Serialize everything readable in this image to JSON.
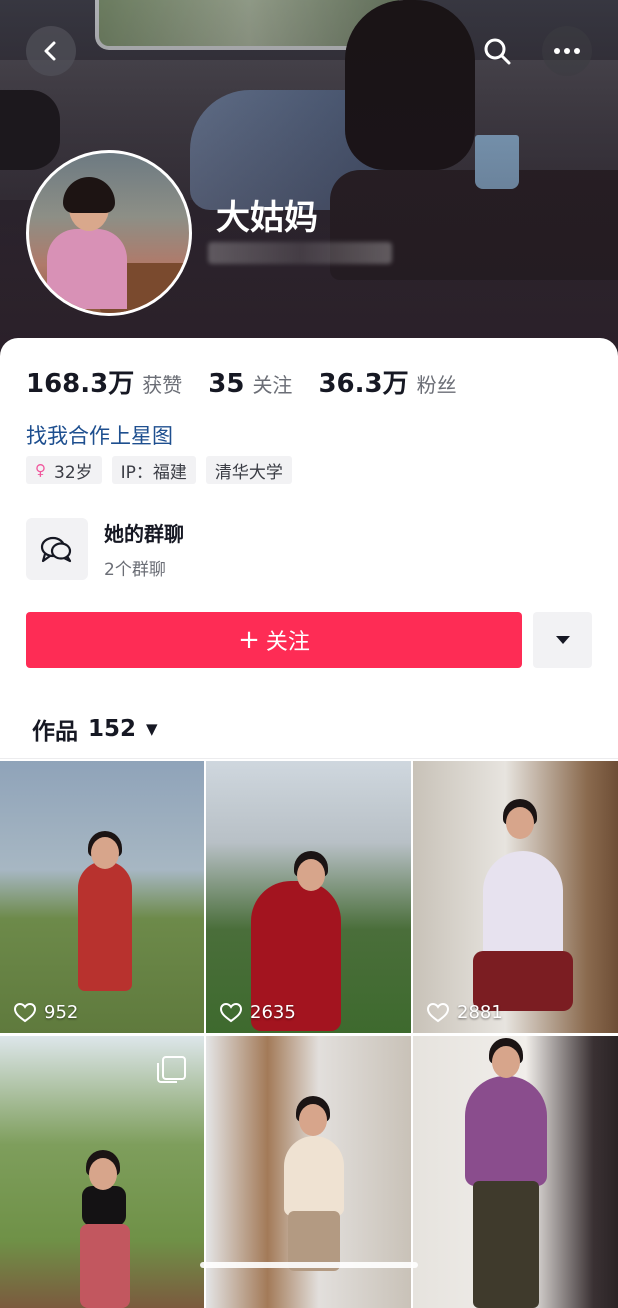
{
  "header": {
    "username": "大姑妈",
    "back_icon": "chevron-left-icon",
    "search_icon": "search-icon",
    "more_icon": "more-dots-icon"
  },
  "stats": [
    {
      "value": "168.3万",
      "label": "获赞"
    },
    {
      "value": "35",
      "label": "关注"
    },
    {
      "value": "36.3万",
      "label": "粉丝"
    }
  ],
  "bio_link": "找我合作上星图",
  "tags": {
    "gender_symbol": "♀",
    "age": "32岁",
    "ip": "IP：福建",
    "school": "清华大学"
  },
  "group_chat": {
    "title": "她的群聊",
    "subtitle": "2个群聊",
    "icon": "chat-bubbles-icon"
  },
  "actions": {
    "follow_plus": "+",
    "follow_label": "关注",
    "dropdown_icon": "caret-down-icon"
  },
  "works_tab": {
    "label": "作品",
    "count": "152",
    "caret": "▼"
  },
  "videos": [
    {
      "likes": "952"
    },
    {
      "likes": "2635"
    },
    {
      "likes": "2881"
    },
    {
      "likes": ""
    },
    {
      "likes": ""
    },
    {
      "likes": ""
    }
  ],
  "colors": {
    "accent": "#fe2c55",
    "link": "#1e4f8f"
  }
}
